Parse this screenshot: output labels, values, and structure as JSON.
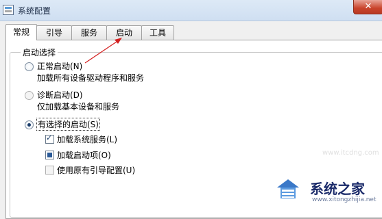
{
  "window": {
    "title": "系统配置",
    "close_label": "✕"
  },
  "tabs": [
    {
      "label": "常规",
      "active": true
    },
    {
      "label": "引导",
      "active": false
    },
    {
      "label": "服务",
      "active": false
    },
    {
      "label": "启动",
      "active": false
    },
    {
      "label": "工具",
      "active": false
    }
  ],
  "startup_group": {
    "label": "启动选择",
    "options": [
      {
        "label": "正常启动(N)",
        "description": "加载所有设备驱动程序和服务",
        "selected": false
      },
      {
        "label": "诊断启动(D)",
        "description": "仅加载基本设备和服务",
        "selected": false
      },
      {
        "label": "有选择的启动(S)",
        "selected": true
      }
    ],
    "selective_items": [
      {
        "label": "加载系统服务(L)",
        "state": "checked"
      },
      {
        "label": "加载启动项(O)",
        "state": "indeterminate"
      },
      {
        "label": "使用原有引导配置(U)",
        "state": "unchecked"
      }
    ]
  },
  "annotation": {
    "arrow_color": "#d42020",
    "points_to": "tab-startup"
  },
  "watermark": {
    "brand": "系统之家",
    "url": "www.xitongzhijia.net",
    "faint": "www.itcdng.com"
  }
}
